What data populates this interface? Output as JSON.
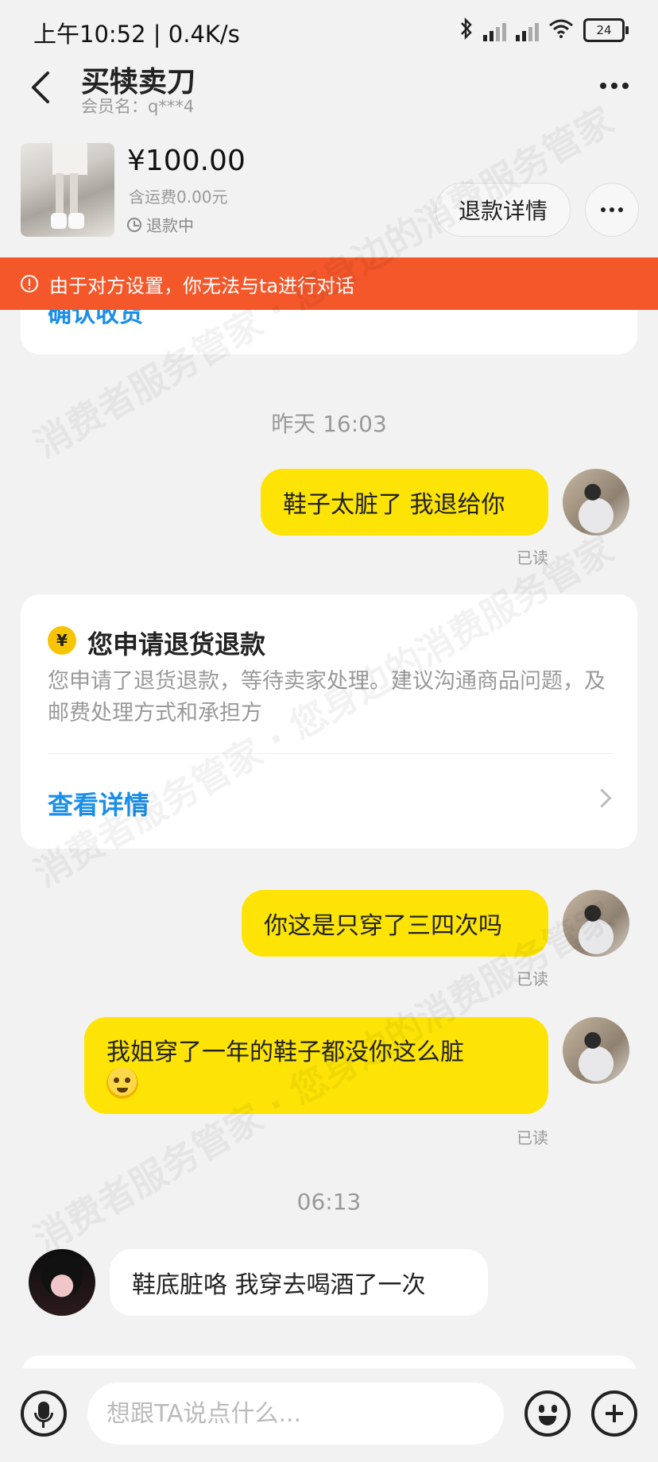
{
  "status_bar": {
    "time": "上午10:52 | 0.4K/s",
    "battery": "24"
  },
  "header": {
    "title": "买犊卖刀",
    "member": "会员名：q***4"
  },
  "order": {
    "price": "¥100.00",
    "shipping": "含运费0.00元",
    "status": "退款中",
    "refund_detail_label": "退款详情"
  },
  "warning": {
    "text": "由于对方设置，你无法与ta进行对话"
  },
  "top_card": {
    "text": "确认收货"
  },
  "messages": {
    "time1": "昨天 16:03",
    "msg1": "鞋子太脏了 我退给你",
    "read1": "已读",
    "refund_card": {
      "icon": "¥",
      "title": "您申请退货退款",
      "desc": "您申请了退货退款，等待卖家处理。建议沟通商品问题，及邮费处理方式和承担方",
      "link": "查看详情"
    },
    "msg2": "你这是只穿了三四次吗",
    "read2": "已读",
    "msg3": "我姐穿了一年的鞋子都没你这么脏",
    "read3": "已读",
    "time2": "06:13",
    "msg4": "鞋底脏咯 我穿去喝酒了一次"
  },
  "input": {
    "placeholder": "想跟TA说点什么..."
  },
  "watermark": "消费者服务管家 · 您身边的消费服务管家",
  "colors": {
    "accent_orange": "#f4572a",
    "bubble_yellow": "#fde406",
    "link_blue": "#1a8ee8"
  }
}
